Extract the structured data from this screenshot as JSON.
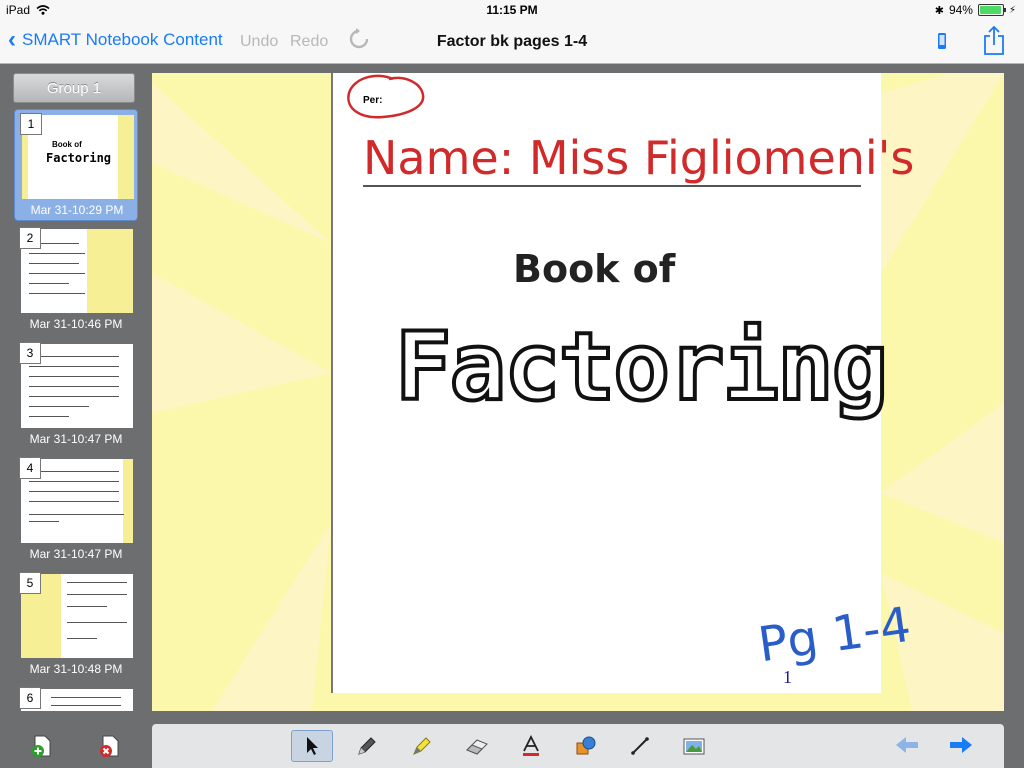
{
  "status_bar": {
    "device": "iPad",
    "time": "11:15 PM",
    "battery": "94%",
    "battery_level": 0.94
  },
  "nav": {
    "back_label": "SMART Notebook Content",
    "undo_label": "Undo",
    "redo_label": "Redo",
    "title": "Factor bk pages 1-4"
  },
  "sidebar": {
    "group_label": "Group 1",
    "pages": [
      {
        "num": "1",
        "timestamp": "Mar 31-10:29 PM",
        "thumb_title_1": "Book of",
        "thumb_title_2": "Factoring"
      },
      {
        "num": "2",
        "timestamp": "Mar 31-10:46 PM"
      },
      {
        "num": "3",
        "timestamp": "Mar 31-10:47 PM"
      },
      {
        "num": "4",
        "timestamp": "Mar 31-10:47 PM"
      },
      {
        "num": "5",
        "timestamp": "Mar 31-10:48 PM"
      },
      {
        "num": "6",
        "timestamp": ""
      }
    ]
  },
  "page": {
    "per_label": "Per:",
    "name_label": "Name: Miss Figliomeni's",
    "title_line1": "Book of",
    "title_line2": "Factoring",
    "pages_note": "Pg 1-4",
    "page_number": "1"
  },
  "colors": {
    "accent": "#1a7cf5",
    "ink_red": "#d02a2a",
    "ink_blue": "#2a5dc8",
    "canvas_bg": "#fcf8ab"
  },
  "toolbar": {
    "tools": [
      "select-icon",
      "pen-icon",
      "highlighter-icon",
      "eraser-icon",
      "text-icon",
      "shapes-icon",
      "line-icon",
      "image-icon"
    ]
  }
}
